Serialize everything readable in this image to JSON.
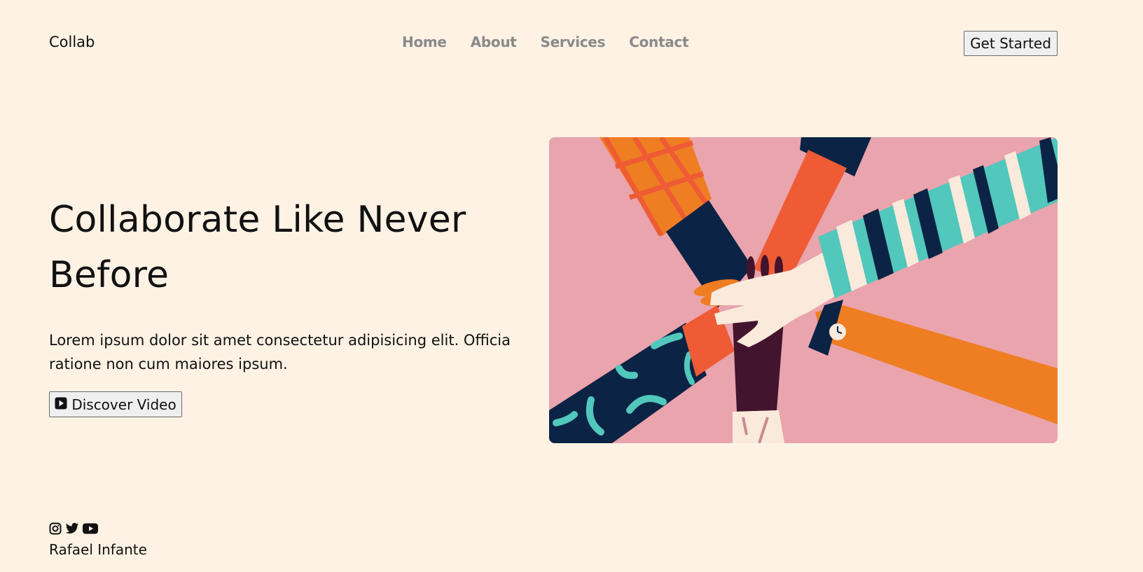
{
  "header": {
    "brand": "Collab",
    "nav": [
      "Home",
      "About",
      "Services",
      "Contact"
    ],
    "cta_label": "Get Started"
  },
  "hero": {
    "title": "Collaborate Like Never Before",
    "description": "Lorem ipsum dolor sit amet consectetur adipisicing elit. Officia ratione non cum maiores ipsum.",
    "video_button_label": "Discover Video",
    "video_button_icon": "play-square-icon",
    "image_alt": "hands-together-illustration"
  },
  "footer": {
    "social_icons": [
      "instagram-icon",
      "twitter-icon",
      "youtube-icon"
    ],
    "author": "Rafael Infante"
  },
  "colors": {
    "background": "#fdf2e4",
    "nav_text": "#8a8a8a",
    "image_background": "#e9a4ad",
    "orange": "#ef7d22",
    "red_orange": "#ee5b35",
    "navy": "#0b2344",
    "teal": "#52c7bc",
    "cream": "#faeadb",
    "plum": "#42142d"
  }
}
